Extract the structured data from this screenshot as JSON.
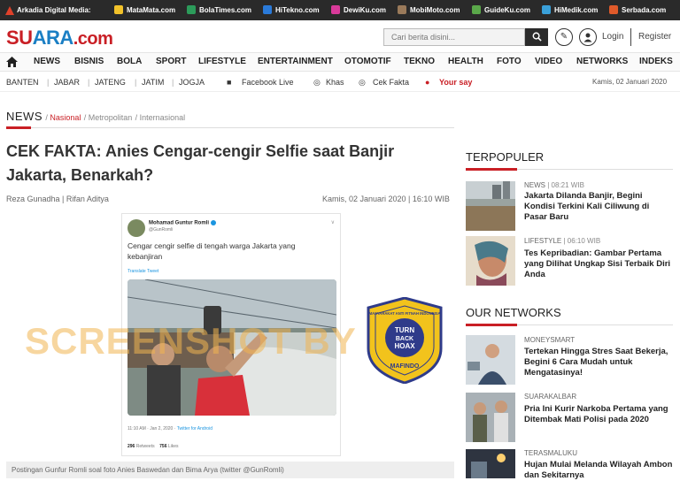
{
  "topbar": {
    "brand": "Arkadia Digital Media:",
    "sites": [
      {
        "label": "MataMata.com",
        "color": "#f2c22a"
      },
      {
        "label": "BolaTimes.com",
        "color": "#2c9b5a"
      },
      {
        "label": "HiTekno.com",
        "color": "#2a7ad9"
      },
      {
        "label": "DewiKu.com",
        "color": "#d93a9a"
      },
      {
        "label": "MobiMoto.com",
        "color": "#9a7a5a"
      },
      {
        "label": "GuideKu.com",
        "color": "#5aa84a"
      },
      {
        "label": "HiMedik.com",
        "color": "#3aa0d9"
      },
      {
        "label": "Serbada.com",
        "color": "#e05a2a"
      }
    ]
  },
  "header": {
    "logo_left": "SU",
    "logo_mid": "ARA",
    "logo_com": ".com",
    "search_placeholder": "Cari berita disini...",
    "login": "Login",
    "register": "Register"
  },
  "nav": {
    "items": [
      "NEWS",
      "BISNIS",
      "BOLA",
      "SPORT",
      "LIFESTYLE",
      "ENTERTAINMENT",
      "OTOMOTIF",
      "TEKNO",
      "HEALTH",
      "FOTO",
      "VIDEO",
      "NETWORKS",
      "INDEKS"
    ]
  },
  "subnav": {
    "regions": [
      "BANTEN",
      "JABAR",
      "JATENG",
      "JATIM",
      "JOGJA"
    ],
    "facebook_live": "Facebook Live",
    "khas": "Khas",
    "cek_fakta": "Cek Fakta",
    "your_say": "Your say",
    "today": "Kamis, 02 Januari 2020"
  },
  "breadcrumb": {
    "section": "NEWS",
    "items": [
      "Nasional",
      "Metropolitan",
      "Internasional"
    ]
  },
  "article": {
    "title": "CEK FAKTA: Anies Cengar-cengir Selfie saat Banjir Jakarta, Benarkah?",
    "authors": "Reza Gunadha | Rifan Aditya",
    "datetime": "Kamis, 02 Januari 2020 | 16:10 WIB",
    "caption": "Postingan Gunfur Romli soal foto Anies Baswedan dan Bima Arya (twitter @GunRomli)",
    "watermark": "SCREENSHOT BY"
  },
  "tweet": {
    "name": "Mohamad Guntur Romli",
    "handle": "@GunRomli",
    "text": "Cengar cengir selfie di tengah warga Jakarta yang kebanjiran",
    "translate": "Translate Tweet",
    "time": "11:10 AM · Jan 2, 2020 · ",
    "source": "Twitter for Android",
    "retweets": "296",
    "retweets_label": "Retweets",
    "likes": "756",
    "likes_label": "Likes"
  },
  "hoax_badge": {
    "line1": "TURN",
    "line2": "BACK",
    "line3": "HOAX",
    "ring": "MASYARAKAT ANTI FITNAH INDONESIA",
    "bottom": "MAFINDO"
  },
  "sidebar": {
    "popular_title": "TERPOPULER",
    "popular": [
      {
        "category": "NEWS",
        "time": "08:21 WIB",
        "headline": "Jakarta Dilanda Banjir, Begini Kondisi Terkini Kali Ciliwung di Pasar Baru"
      },
      {
        "category": "LIFESTYLE",
        "time": "06:10 WIB",
        "headline": "Tes Kepribadian: Gambar Pertama yang Dilihat Ungkap Sisi Terbaik Diri Anda"
      }
    ],
    "networks_title": "OUR NETWORKS",
    "networks": [
      {
        "category": "MONEYSMART",
        "headline": "Tertekan Hingga Stres Saat Bekerja, Begini 6 Cara Mudah untuk Mengatasinya!"
      },
      {
        "category": "SUARAKALBAR",
        "headline": "Pria Ini Kurir Narkoba Pertama yang Ditembak Mati Polisi pada 2020"
      },
      {
        "category": "TERASMALUKU",
        "headline": "Hujan Mulai Melanda Wilayah Ambon dan Sekitarnya"
      }
    ]
  }
}
